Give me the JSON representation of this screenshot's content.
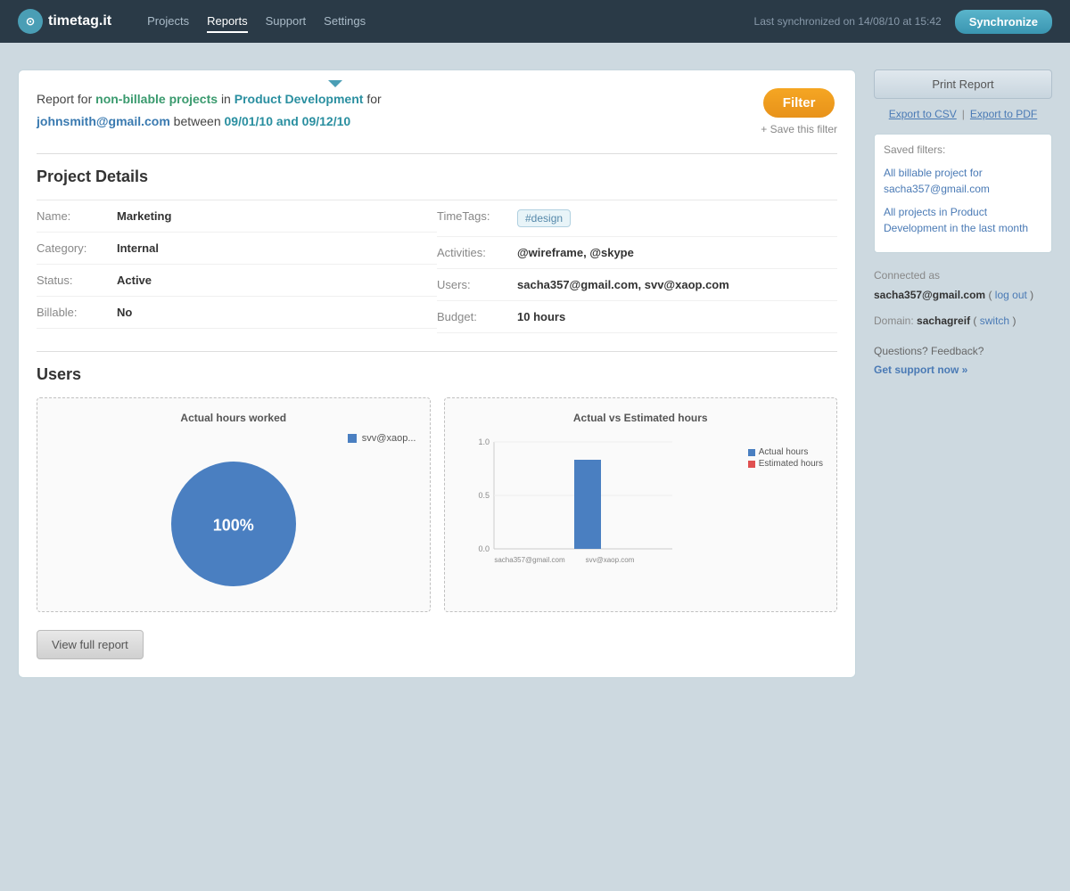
{
  "header": {
    "logo_text": "timetag.it",
    "nav": [
      {
        "label": "Projects",
        "active": false
      },
      {
        "label": "Reports",
        "active": true
      },
      {
        "label": "Support",
        "active": false
      },
      {
        "label": "Settings",
        "active": false
      }
    ],
    "sync_text": "Last synchronized on 14/08/10 at 15:42",
    "sync_button": "Synchronize"
  },
  "report": {
    "prefix": "Report for",
    "project_type": "non-billable projects",
    "in_text": "in",
    "project_name": "Product Development",
    "for_text": "for",
    "user_email": "johnsmith@gmail.com",
    "between_text": "between",
    "date_range": "09/01/10 and 09/12/10",
    "filter_button": "Filter",
    "save_filter": "+ Save this filter"
  },
  "project_details": {
    "section_title": "Project Details",
    "fields": {
      "name_label": "Name:",
      "name_value": "Marketing",
      "category_label": "Category:",
      "category_value": "Internal",
      "status_label": "Status:",
      "status_value": "Active",
      "billable_label": "Billable:",
      "billable_value": "No",
      "timetags_label": "TimeTags:",
      "timetags_value": "#design",
      "activities_label": "Activities:",
      "activities_value": "@wireframe, @skype",
      "users_label": "Users:",
      "users_value": "sacha357@gmail.com, svv@xaop.com",
      "budget_label": "Budget:",
      "budget_value": "10 hours"
    }
  },
  "users": {
    "section_title": "Users",
    "pie_chart": {
      "title": "Actual hours worked",
      "legend_label": "svv@xaop...",
      "percentage": "100%"
    },
    "bar_chart": {
      "title": "Actual vs Estimated hours",
      "y_labels": [
        "1.0",
        "0.5",
        "0.0"
      ],
      "x_labels": [
        "sacha357@gmail.com",
        "svv@xaop.com"
      ],
      "legend_actual": "Actual hours",
      "legend_estimated": "Estimated hours"
    },
    "view_full_report": "View full report"
  },
  "sidebar": {
    "print_button": "Print Report",
    "export_csv": "Export to CSV",
    "export_sep": "|",
    "export_pdf": "Export to PDF",
    "saved_filters_title": "Saved filters:",
    "saved_filters": [
      "All billable project for sacha357@gmail.com",
      "All projects in Product Development in the last month"
    ],
    "connected_label": "Connected as",
    "connected_email": "sacha357@gmail.com",
    "logout_link": "log out",
    "domain_label": "Domain:",
    "domain_value": "sachagreif",
    "switch_link": "switch",
    "questions_text": "Questions? Feedback?",
    "support_link": "Get support now »"
  }
}
